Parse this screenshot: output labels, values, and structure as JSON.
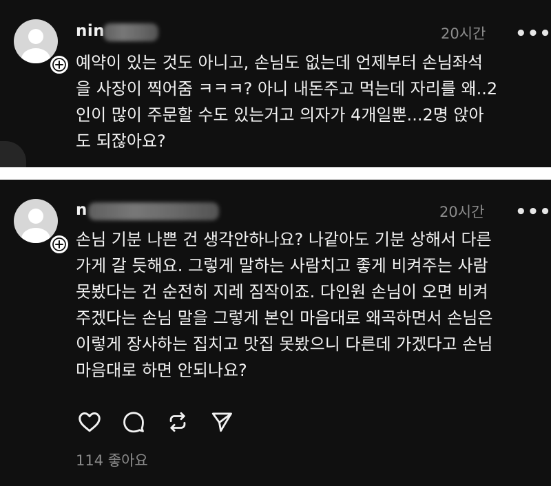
{
  "posts": [
    {
      "username": "nin",
      "timestamp": "20시간",
      "more_label": "•••",
      "comment": "예약이 있는 것도 아니고, 손님도 없는데 언제부터 손님좌석\n을 사장이 찍어줌 ㅋㅋㅋ? 아니 내돈주고 먹는데 자리를 왜..2\n인이 많이 주문할 수도 있는거고 의자가 4개일뿐...2명 앉아\n도 되잖아요?"
    },
    {
      "username": "n",
      "timestamp": "20시간",
      "more_label": "•••",
      "comment": "손님 기분 나쁜 건 생각안하나요? 나같아도 기분 상해서 다른\n가게 갈 듯해요. 그렇게 말하는 사람치고 좋게 비켜주는 사람\n못봤다는 건 순전히 지레 짐작이죠. 다인원 손님이 오면 비켜\n주겠다는 손님 말을 그렇게 본인 마음대로 왜곡하면서 손님은\n이렇게 장사하는 집치고 맛집 못봤으니 다른데 가겠다고 손님\n마음대로 하면 안되나요?",
      "likes": "114 좋아요"
    }
  ],
  "icons": {
    "avatar": "avatar-icon",
    "follow": "plus-icon",
    "like": "heart-icon",
    "reply": "comment-icon",
    "repost": "repost-icon",
    "share": "send-icon"
  },
  "colors": {
    "background": "#101010",
    "separator": "#ffffff",
    "text": "#f2f2f2",
    "muted": "#8c8c8c"
  }
}
